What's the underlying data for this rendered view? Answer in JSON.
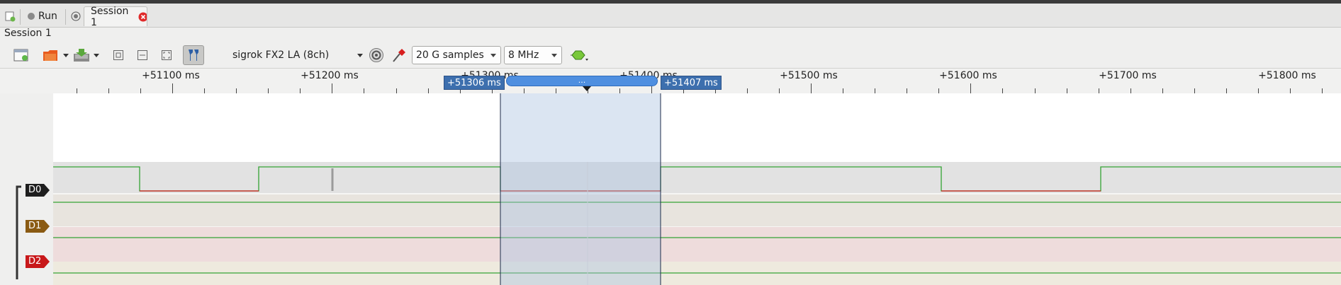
{
  "tabs": [
    {
      "label": "Run"
    },
    {
      "label": "Session 1"
    }
  ],
  "session_title": "Session 1",
  "toolbar": {
    "device": "sigrok FX2 LA (8ch)",
    "samples": "20 G samples",
    "samplerate": "8 MHz"
  },
  "ruler": {
    "ticks": [
      "+51100 ms",
      "+51200 ms",
      "+51300 ms",
      "+51400 ms",
      "+51500 ms",
      "+51600 ms",
      "+51700 ms",
      "+51800 ms"
    ],
    "cursor_a": "+51306 ms",
    "cursor_b": "+51407 ms",
    "cursor_handle": "..."
  },
  "channels": [
    {
      "name": "D0",
      "color": "#1e1e1e"
    },
    {
      "name": "D1",
      "color": "#8a5a12"
    },
    {
      "name": "D2",
      "color": "#c8181a"
    }
  ],
  "colors": {
    "high_trace": "#34a334",
    "low_trace": "#d01818",
    "cursor_region": "#a9c0e0",
    "flag": "#3d6fae"
  }
}
